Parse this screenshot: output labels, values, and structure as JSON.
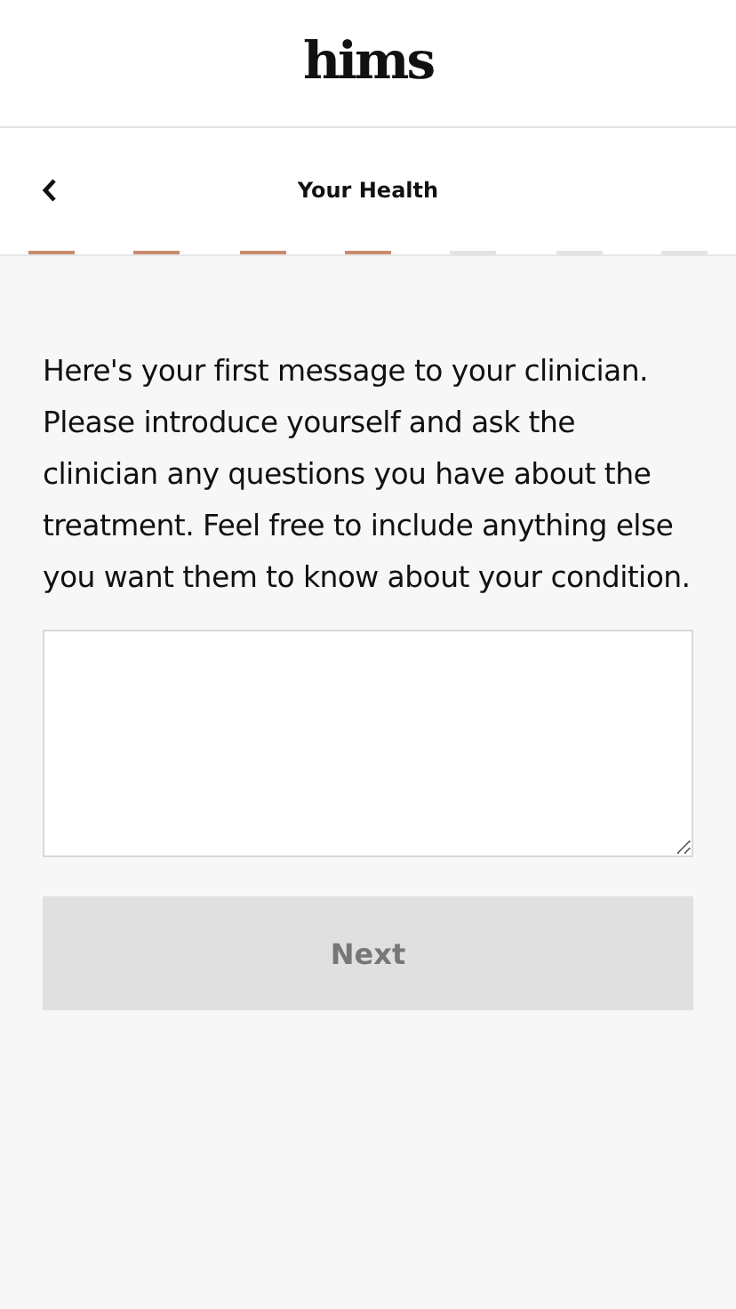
{
  "logo": "hims",
  "nav": {
    "title": "Your Health"
  },
  "progress": [
    {
      "done": true
    },
    {
      "done": true
    },
    {
      "done": true
    },
    {
      "done": true
    },
    {
      "done": false
    },
    {
      "done": false
    },
    {
      "done": false
    }
  ],
  "message": "Here's your first message to your clinician. Please introduce yourself and ask the clinician any questions you have about the treatment. Feel free to include anything else you want them to know about your condition.",
  "next_button": {
    "label": "Next",
    "disabled": true
  }
}
